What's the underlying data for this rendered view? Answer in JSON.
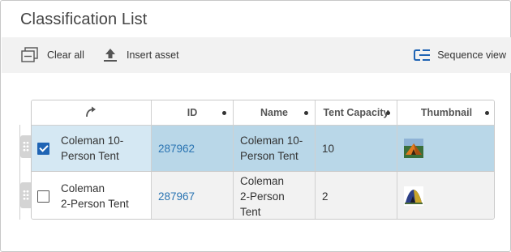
{
  "panel": {
    "title": "Classification List"
  },
  "toolbar": {
    "clear_all": "Clear all",
    "insert_asset": "Insert asset",
    "sequence_view": "Sequence view"
  },
  "grid": {
    "columns": [
      "",
      "ID",
      "Name",
      "Tent Capacity",
      "Thumbnail"
    ],
    "rows": [
      {
        "checked": true,
        "label": "Coleman 10-Person Tent",
        "label_lines": [
          "Coleman 10-",
          "Person Tent"
        ],
        "id": "287962",
        "name_lines": [
          "Coleman 10-",
          "Person Tent"
        ],
        "capacity": "10",
        "thumbnail": "orange-tent-image"
      },
      {
        "checked": false,
        "label": "Coleman 2-Person Tent",
        "label_lines": [
          "Coleman",
          "2-Person Tent"
        ],
        "id": "287967",
        "name_lines": [
          "Coleman",
          "2-Person",
          "Tent"
        ],
        "capacity": "2",
        "thumbnail": "blue-tent-image"
      }
    ]
  },
  "colors": {
    "selected_row": "#b9d7e8",
    "link": "#2a74b2",
    "checkbox": "#1f64b4"
  },
  "icons": [
    "clear-all-icon",
    "upload-icon",
    "sequence-view-icon",
    "reorder-arrow-icon",
    "drag-handle-icon"
  ]
}
